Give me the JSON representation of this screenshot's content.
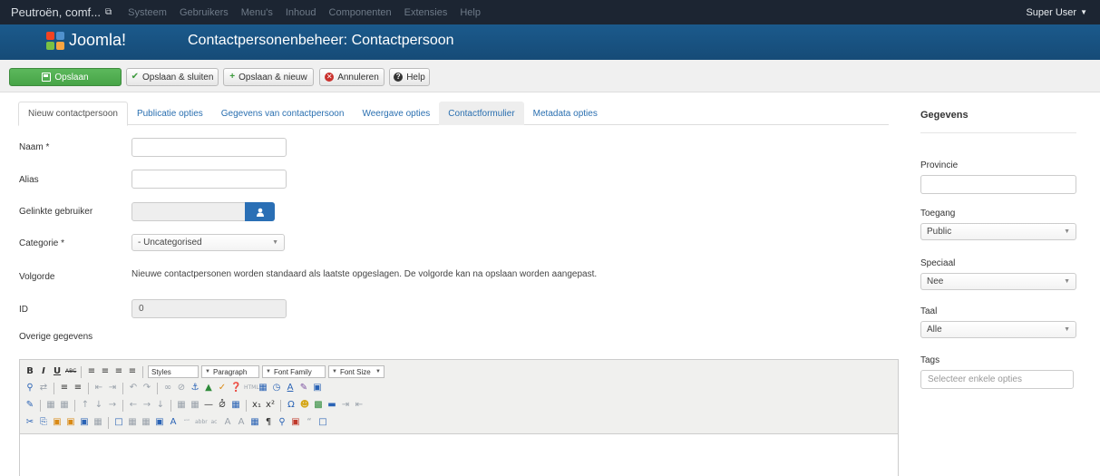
{
  "topnav": {
    "site": "Peutroën, comf...",
    "menu": [
      "Systeem",
      "Gebruikers",
      "Menu's",
      "Inhoud",
      "Componenten",
      "Extensies",
      "Help"
    ],
    "user": "Super User"
  },
  "header": {
    "logo": "Joomla!",
    "title": "Contactpersonenbeheer: Contactpersoon"
  },
  "toolbar": {
    "save": "Opslaan",
    "save_close": "Opslaan & sluiten",
    "save_new": "Opslaan & nieuw",
    "cancel": "Annuleren",
    "help": "Help"
  },
  "tabs": [
    "Nieuw contactpersoon",
    "Publicatie opties",
    "Gegevens van contactpersoon",
    "Weergave opties",
    "Contactformulier",
    "Metadata opties"
  ],
  "form": {
    "name_label": "Naam *",
    "alias_label": "Alias",
    "linked_user_label": "Gelinkte gebruiker",
    "category_label": "Categorie *",
    "category_value": "- Uncategorised",
    "order_label": "Volgorde",
    "order_note": "Nieuwe contactpersonen worden standaard als laatste opgeslagen. De volgorde kan na opslaan worden aangepast.",
    "id_label": "ID",
    "id_value": "0",
    "misc_label": "Overige gegevens"
  },
  "editor": {
    "styles": "Styles",
    "paragraph": "Paragraph",
    "font_family": "Font Family",
    "font_size": "Font Size"
  },
  "sidebar": {
    "title": "Gegevens",
    "province_label": "Provincie",
    "access_label": "Toegang",
    "access_value": "Public",
    "featured_label": "Speciaal",
    "featured_value": "Nee",
    "language_label": "Taal",
    "language_value": "Alle",
    "tags_label": "Tags",
    "tags_placeholder": "Selecteer enkele opties"
  },
  "colors": {
    "topnav": "#1c2532",
    "header": "#1b5a8c",
    "save": "#5cb85c",
    "link": "#2a6fb0"
  }
}
